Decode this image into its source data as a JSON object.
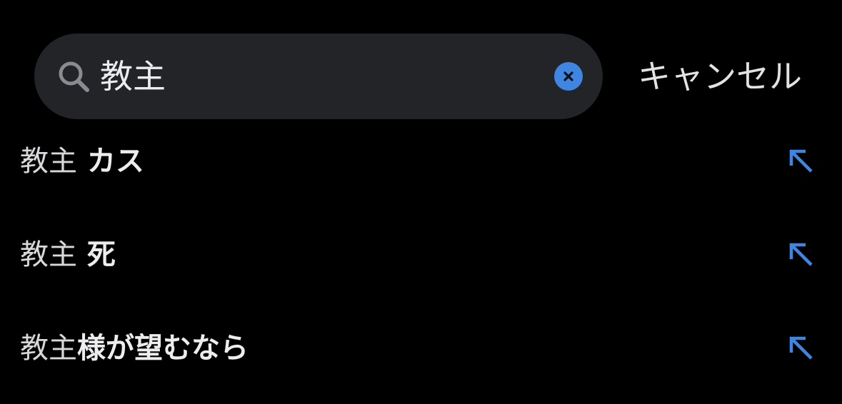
{
  "search": {
    "query": "教主",
    "cancel_label": "キャンセル",
    "icons": {
      "search": "magnifier-icon",
      "clear": "clear-x-icon"
    },
    "accent_color": "#3f86e2"
  },
  "suggestions": [
    {
      "match": "教主",
      "rest": " カス",
      "icon": "fill-arrow-icon"
    },
    {
      "match": "教主",
      "rest": " 死",
      "icon": "fill-arrow-icon"
    },
    {
      "match": "教主",
      "rest": "様が望むなら",
      "icon": "fill-arrow-icon"
    }
  ]
}
